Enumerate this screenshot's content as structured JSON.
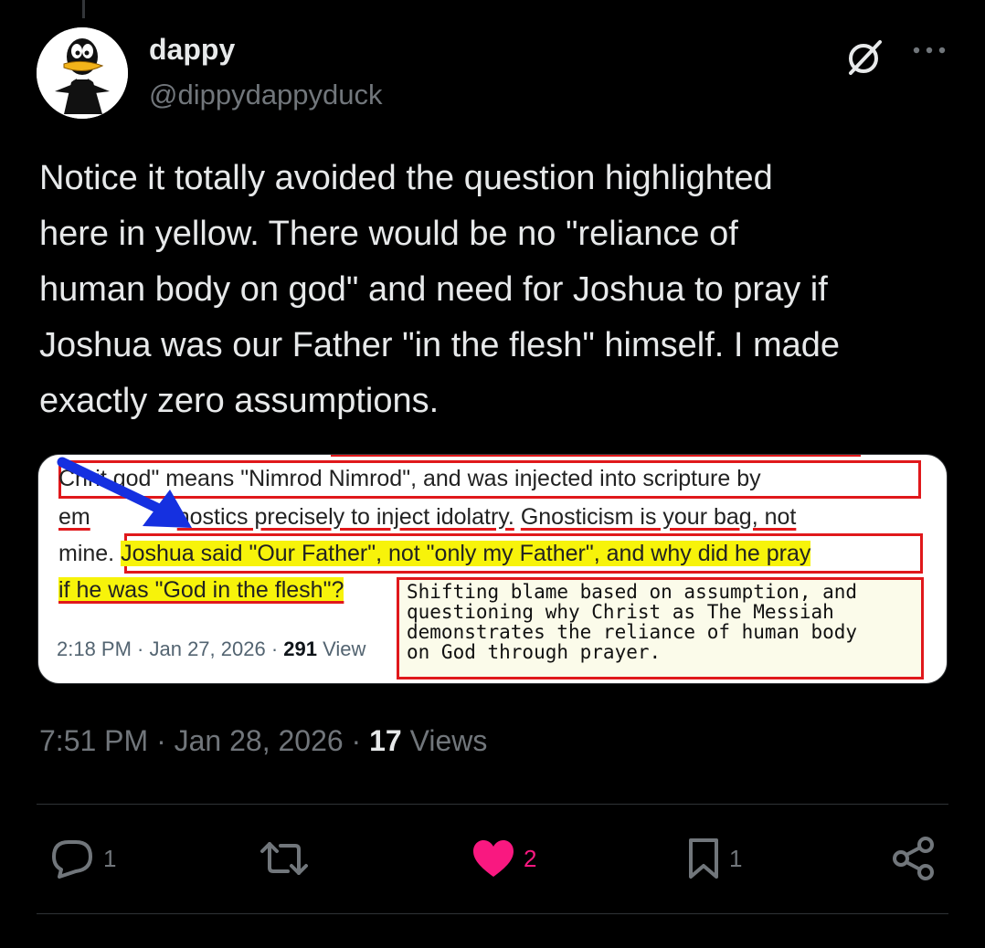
{
  "author": {
    "display_name": "dappy",
    "handle": "@dippydappyduck"
  },
  "tweet": {
    "text": "Notice it totally avoided the question highlighted\nhere in yellow. There would be no \"reliance of\nhuman body on god\" and need for Joshua to pray if\nJoshua was our Father \"in the flesh\" himself. I made\nexactly zero assumptions.",
    "time": "7:51 PM",
    "date": "Jan 28, 2026",
    "views_count": "17",
    "views_label": "Views"
  },
  "media": {
    "line1_a": "t god\" means \"Nimrod Nimrod\", and was injected  into scripture by",
    "line1_b": "Chri",
    "line2_a": "em",
    "line2_b": "nostics precisely to inject idolatry.",
    "line2_c": "Gnosticism is your bag, not",
    "line3_a": "mine.",
    "line3_b": "Joshua said \"Our Father\", not \"only my Father\", and why did he pray",
    "line4_a": "if he was \"God in the flesh\"?",
    "small_time": "2:18 PM · Jan 27, 2026 · ",
    "small_views_count": "291",
    "small_views_label": " View",
    "reply_text": "Shifting blame based on assumption, and\nquestioning why Christ as The Messiah\ndemonstrates the reliance of human body\non God through prayer."
  },
  "actions": {
    "replies": "1",
    "reposts": "",
    "likes": "2",
    "bookmarks": "1"
  },
  "colors": {
    "like": "#f91880",
    "muted": "#71767b",
    "highlight": "#f7f30a",
    "annotation_red": "#e0181b",
    "arrow_blue": "#1530e0"
  },
  "icons": [
    "grok-icon",
    "more-icon",
    "reply-icon",
    "repost-icon",
    "like-icon",
    "bookmark-icon",
    "share-icon"
  ]
}
